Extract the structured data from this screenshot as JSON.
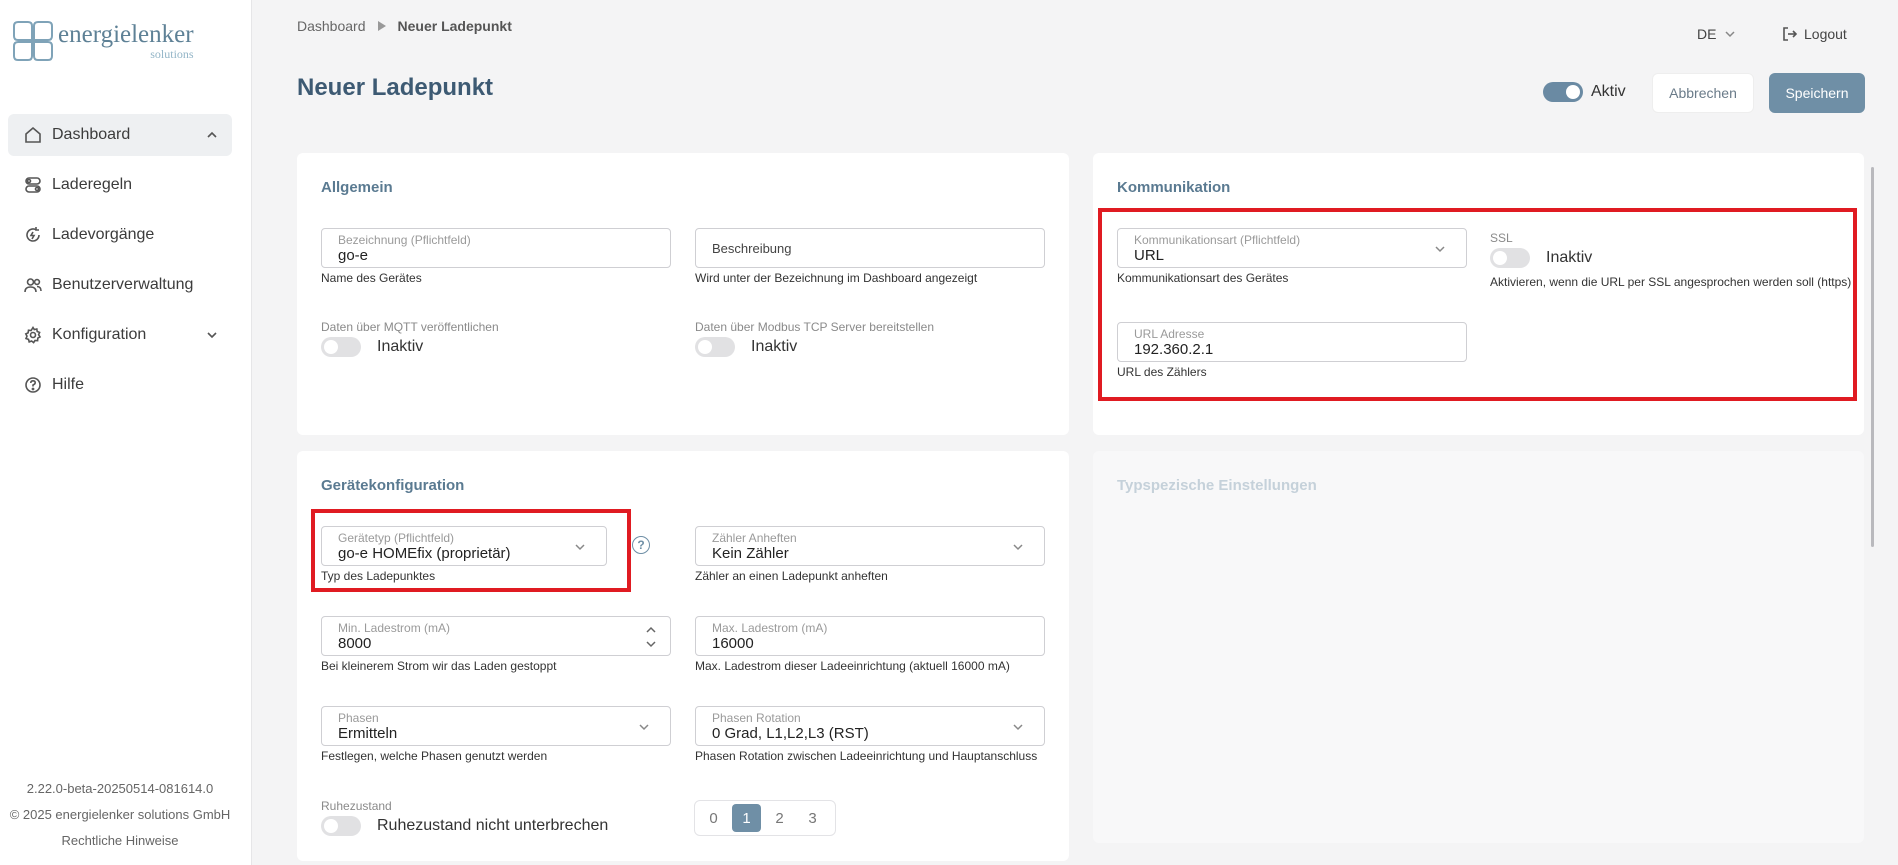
{
  "logo": {
    "name": "energielenker",
    "sub": "solutions"
  },
  "nav": {
    "items": [
      {
        "label": "Dashboard"
      },
      {
        "label": "Laderegeln"
      },
      {
        "label": "Ladevorgänge"
      },
      {
        "label": "Benutzerverwaltung"
      },
      {
        "label": "Konfiguration"
      },
      {
        "label": "Hilfe"
      }
    ]
  },
  "footer": {
    "version": "2.22.0-beta-20250514-081614.0",
    "copyright": "© 2025 energielenker solutions GmbH",
    "legal": "Rechtliche Hinweise"
  },
  "breadcrumb": {
    "root": "Dashboard",
    "current": "Neuer Ladepunkt"
  },
  "header": {
    "lang": "DE",
    "logout": "Logout"
  },
  "page": {
    "title": "Neuer Ladepunkt",
    "active_label": "Aktiv",
    "active_on": true,
    "cancel_label": "Abbrechen",
    "save_label": "Speichern"
  },
  "allgemein": {
    "title": "Allgemein",
    "bezeichnung": {
      "label": "Bezeichnung (Pflichtfeld)",
      "value": "go-e",
      "hint": "Name des Gerätes"
    },
    "beschreibung": {
      "placeholder": "Beschreibung",
      "hint": "Wird unter der Bezeichnung im Dashboard angezeigt"
    },
    "mqtt": {
      "label": "Daten über MQTT veröffentlichen",
      "state": "Inaktiv",
      "on": false
    },
    "modbus": {
      "label": "Daten über Modbus TCP Server bereitstellen",
      "state": "Inaktiv",
      "on": false
    }
  },
  "kommunikation": {
    "title": "Kommunikation",
    "art": {
      "label": "Kommunikationsart (Pflichtfeld)",
      "value": "URL",
      "hint": "Kommunikationsart des Gerätes"
    },
    "ssl": {
      "label": "SSL",
      "state": "Inaktiv",
      "on": false,
      "hint": "Aktivieren, wenn die URL per SSL angesprochen werden soll (https)"
    },
    "url": {
      "label": "URL Adresse",
      "value": "192.360.2.1",
      "hint": "URL des Zählers"
    }
  },
  "geraet": {
    "title": "Gerätekonfiguration",
    "typ": {
      "label": "Gerätetyp (Pflichtfeld)",
      "value": "go-e HOMEfix (proprietär)",
      "hint": "Typ des Ladepunktes"
    },
    "zaehler": {
      "label": "Zähler Anheften",
      "value": "Kein Zähler",
      "hint": "Zähler an einen Ladepunkt anheften"
    },
    "min": {
      "label": "Min. Ladestrom (mA)",
      "value": "8000",
      "hint": "Bei kleinerem Strom wir das Laden gestoppt"
    },
    "max": {
      "label": "Max. Ladestrom (mA)",
      "value": "16000",
      "hint": "Max. Ladestrom dieser Ladeeinrichtung (aktuell 16000 mA)"
    },
    "phasen": {
      "label": "Phasen",
      "value": "Ermitteln",
      "hint": "Festlegen, welche Phasen genutzt werden"
    },
    "rotation": {
      "label": "Phasen Rotation",
      "value": "0 Grad, L1,L2,L3 (RST)",
      "hint": "Phasen Rotation zwischen Ladeeinrichtung und Hauptanschluss"
    },
    "ruhezustand": {
      "label": "Ruhezustand",
      "state": "Ruhezustand nicht unterbrechen",
      "on": false
    },
    "prio": {
      "options": [
        "0",
        "1",
        "2",
        "3"
      ],
      "selected": "1"
    }
  },
  "typ_settings": {
    "title": "Typspezische Einstellungen"
  },
  "colors": {
    "accent": "#6f8fa6",
    "title": "#3d5a73",
    "highlight": "#e01b22"
  }
}
